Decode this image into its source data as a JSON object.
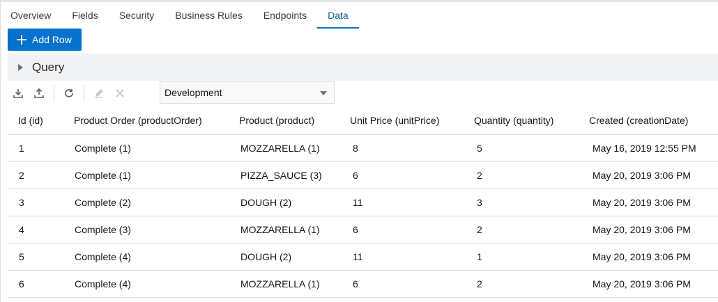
{
  "tabs": [
    {
      "label": "Overview"
    },
    {
      "label": "Fields"
    },
    {
      "label": "Security"
    },
    {
      "label": "Business Rules"
    },
    {
      "label": "Endpoints"
    },
    {
      "label": "Data"
    }
  ],
  "active_tab": "Data",
  "add_row_label": "Add Row",
  "query": {
    "label": "Query"
  },
  "toolbar": {
    "icons": [
      "download-icon",
      "upload-icon",
      "refresh-icon",
      "edit-icon",
      "delete-icon"
    ],
    "environment": "Development"
  },
  "table": {
    "columns": [
      "Id (id)",
      "Product Order (productOrder)",
      "Product (product)",
      "Unit Price (unitPrice)",
      "Quantity (quantity)",
      "Created (creationDate)"
    ],
    "rows": [
      [
        "1",
        "Complete (1)",
        "MOZZARELLA (1)",
        "8",
        "5",
        "May 16, 2019 12:55 PM"
      ],
      [
        "2",
        "Complete (1)",
        "PIZZA_SAUCE (3)",
        "6",
        "2",
        "May 20, 2019 3:06 PM"
      ],
      [
        "3",
        "Complete (2)",
        "DOUGH (2)",
        "11",
        "3",
        "May 20, 2019 3:06 PM"
      ],
      [
        "4",
        "Complete (3)",
        "MOZZARELLA (1)",
        "6",
        "2",
        "May 20, 2019 3:06 PM"
      ],
      [
        "5",
        "Complete (4)",
        "DOUGH (2)",
        "11",
        "1",
        "May 20, 2019 3:06 PM"
      ],
      [
        "6",
        "Complete (4)",
        "MOZZARELLA (1)",
        "6",
        "2",
        "May 20, 2019 3:06 PM"
      ]
    ]
  },
  "colors": {
    "accent": "#0572ce",
    "active_tab_text": "#0a5c8f",
    "query_bg": "#f1f2f3"
  }
}
